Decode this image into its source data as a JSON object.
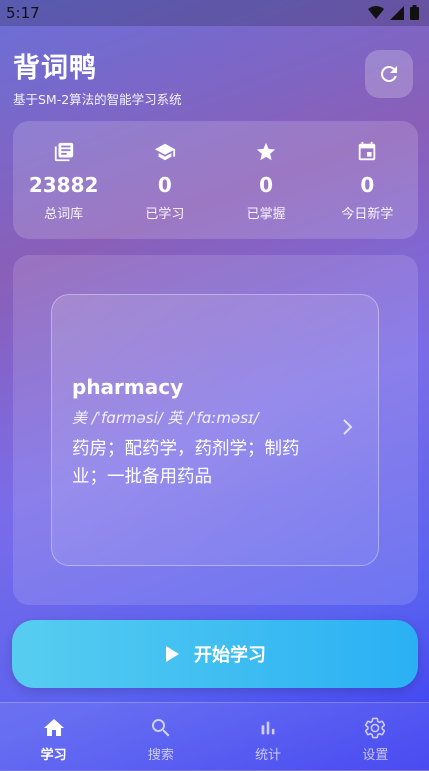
{
  "status": {
    "time": "5:17"
  },
  "header": {
    "title": "背词鸭",
    "subtitle": "基于SM-2算法的智能学习系统",
    "refresh_icon": "refresh-icon"
  },
  "stats": [
    {
      "icon": "book-icon",
      "value": "23882",
      "label": "总词库"
    },
    {
      "icon": "graduation-cap-icon",
      "value": "0",
      "label": "已学习"
    },
    {
      "icon": "star-icon",
      "value": "0",
      "label": "已掌握"
    },
    {
      "icon": "calendar-icon",
      "value": "0",
      "label": "今日新学"
    }
  ],
  "card": {
    "word": "pharmacy",
    "phonetic": "美 /ˈfɑrməsi/  英 /ˈfɑːməsɪ/",
    "meaning": "药房；配药学，药剂学；制药业；一批备用药品"
  },
  "start_button": {
    "label": "开始学习",
    "icon": "play-icon"
  },
  "nav": [
    {
      "icon": "home-icon",
      "label": "学习",
      "active": true
    },
    {
      "icon": "search-icon",
      "label": "搜索",
      "active": false
    },
    {
      "icon": "bar-chart-icon",
      "label": "统计",
      "active": false
    },
    {
      "icon": "gear-icon",
      "label": "设置",
      "active": false
    }
  ]
}
